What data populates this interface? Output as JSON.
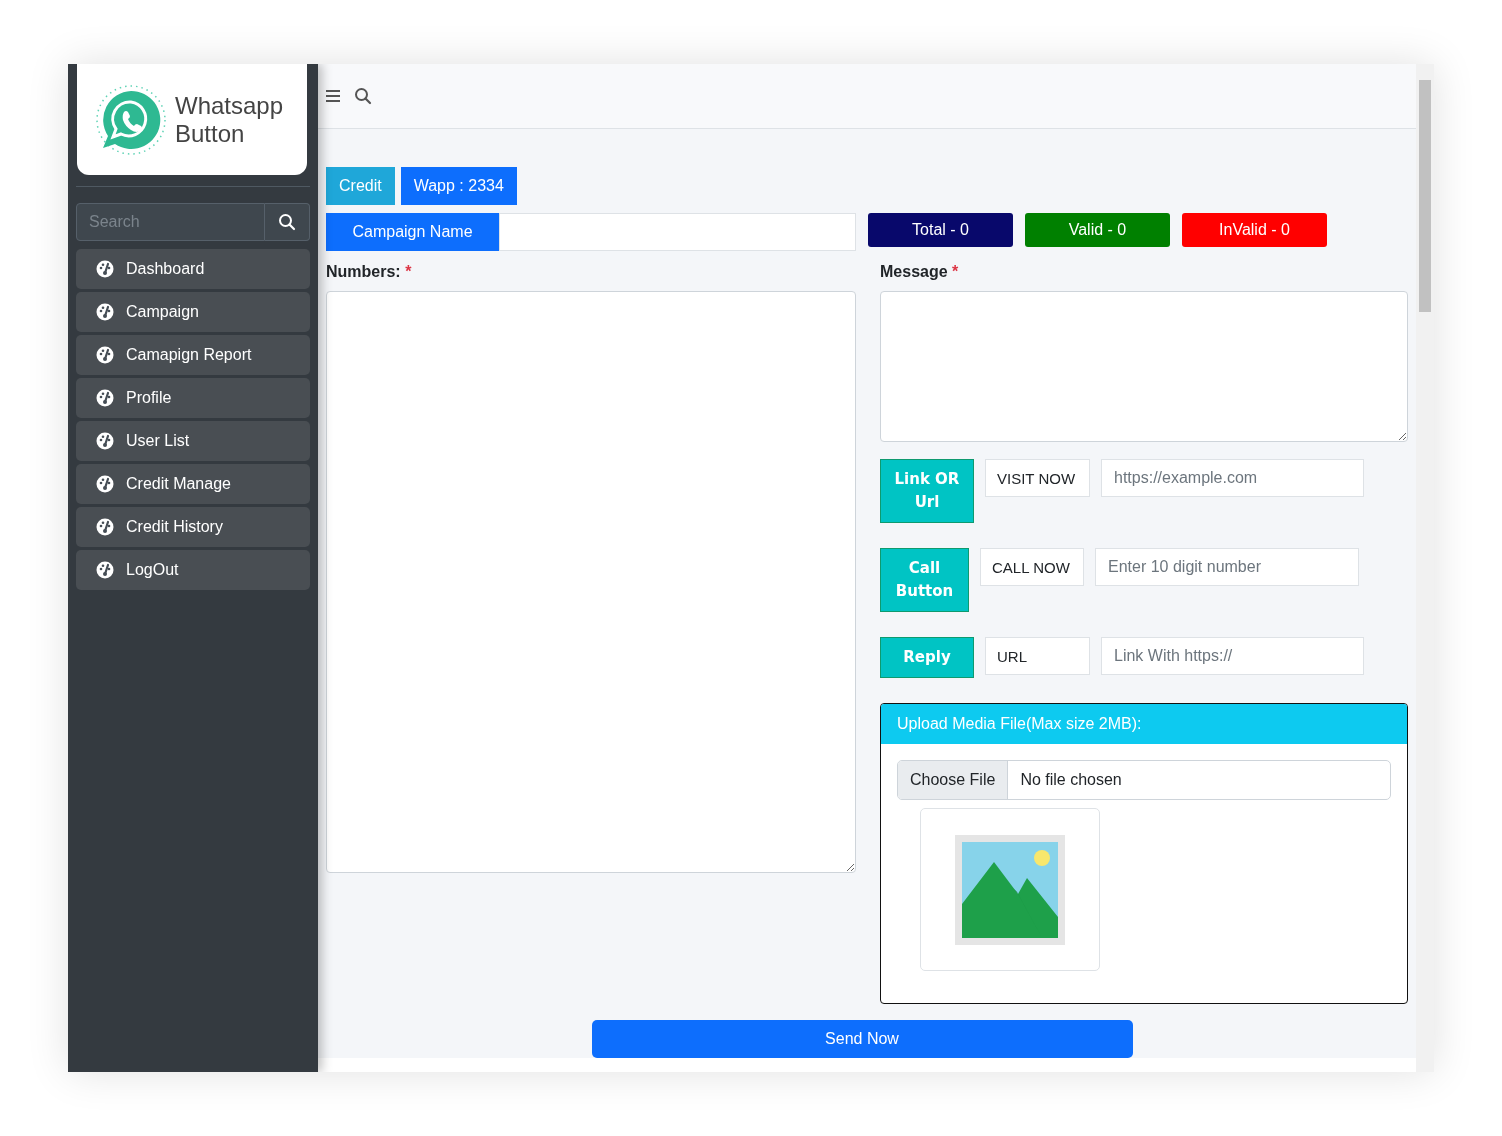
{
  "brand": {
    "title": "Whatsapp Button"
  },
  "sidebar": {
    "search": {
      "placeholder": "Search"
    },
    "items": [
      {
        "label": "Dashboard"
      },
      {
        "label": "Campaign"
      },
      {
        "label": "Camapign Report"
      },
      {
        "label": "Profile"
      },
      {
        "label": "User List"
      },
      {
        "label": "Credit Manage"
      },
      {
        "label": "Credit History"
      },
      {
        "label": "LogOut"
      }
    ]
  },
  "badges": [
    {
      "label": "Credit",
      "color": "#1fa7d9"
    },
    {
      "label": "Wapp : 2334",
      "color": "#0d6efd"
    }
  ],
  "campaign_name": {
    "label": "Campaign Name"
  },
  "counters": [
    {
      "label": "Total - 0",
      "color": "#08086b"
    },
    {
      "label": "Valid - 0",
      "color": "#008000"
    },
    {
      "label": "InValid - 0",
      "color": "#ff0000"
    }
  ],
  "numbers": {
    "label": "Numbers:",
    "mark": "*"
  },
  "message": {
    "label": "Message",
    "mark": "*"
  },
  "action_rows": [
    {
      "button": "Link OR Url",
      "value": "VISIT NOW",
      "placeholder": "https://example.com"
    },
    {
      "button": "Call Button",
      "value": "CALL NOW",
      "placeholder": "Enter 10 digit number"
    },
    {
      "button": "Reply",
      "value": "URL",
      "placeholder": "Link With https://"
    }
  ],
  "upload": {
    "title": "Upload Media File(Max size 2MB):",
    "choose_button": "Choose File",
    "file_status": "No file chosen"
  },
  "send_button": "Send Now"
}
